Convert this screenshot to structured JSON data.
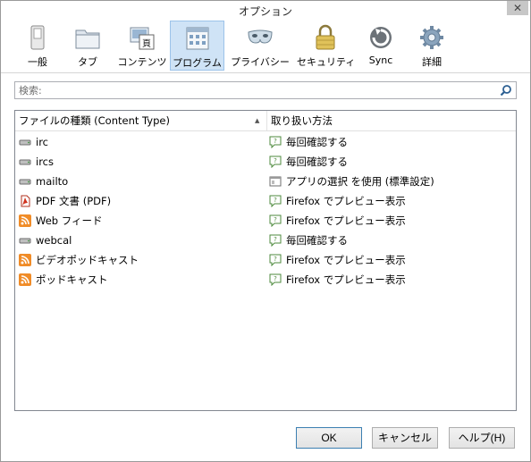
{
  "window": {
    "title": "オプション",
    "close": "✕"
  },
  "toolbar": {
    "items": [
      {
        "label": "一般",
        "icon": "switch-icon"
      },
      {
        "label": "タブ",
        "icon": "tab-folder-icon"
      },
      {
        "label": "コンテンツ",
        "icon": "content-page-icon"
      },
      {
        "label": "プログラム",
        "icon": "applications-icon",
        "selected": true
      },
      {
        "label": "プライバシー",
        "icon": "privacy-mask-icon"
      },
      {
        "label": "セキュリティ",
        "icon": "padlock-icon"
      },
      {
        "label": "Sync",
        "icon": "sync-icon"
      },
      {
        "label": "詳細",
        "icon": "gear-icon"
      }
    ]
  },
  "search": {
    "placeholder": "検索:",
    "value": ""
  },
  "table": {
    "columns": [
      "ファイルの種類 (Content Type)",
      "取り扱い方法"
    ],
    "rows": [
      {
        "type": "irc",
        "type_icon": "drive-icon",
        "action": "毎回確認する",
        "action_icon": "ask-icon"
      },
      {
        "type": "ircs",
        "type_icon": "drive-icon",
        "action": "毎回確認する",
        "action_icon": "ask-icon"
      },
      {
        "type": "mailto",
        "type_icon": "drive-icon",
        "action": "アプリの選択 を使用 (標準設定)",
        "action_icon": "app-icon"
      },
      {
        "type": "PDF 文書 (PDF)",
        "type_icon": "pdf-icon",
        "action": "Firefox でプレビュー表示",
        "action_icon": "ask-icon"
      },
      {
        "type": "Web フィード",
        "type_icon": "rss-icon",
        "action": "Firefox でプレビュー表示",
        "action_icon": "ask-icon"
      },
      {
        "type": "webcal",
        "type_icon": "drive-icon",
        "action": "毎回確認する",
        "action_icon": "ask-icon"
      },
      {
        "type": "ビデオポッドキャスト",
        "type_icon": "rss-icon",
        "action": "Firefox でプレビュー表示",
        "action_icon": "ask-icon"
      },
      {
        "type": "ポッドキャスト",
        "type_icon": "rss-icon",
        "action": "Firefox でプレビュー表示",
        "action_icon": "ask-icon"
      }
    ]
  },
  "buttons": {
    "ok": "OK",
    "cancel": "キャンセル",
    "help": "ヘルプ(H)"
  },
  "colors": {
    "selected_tab": "#cfe3f6",
    "rss_orange": "#f08c28",
    "accent": "#3c7fb1"
  }
}
